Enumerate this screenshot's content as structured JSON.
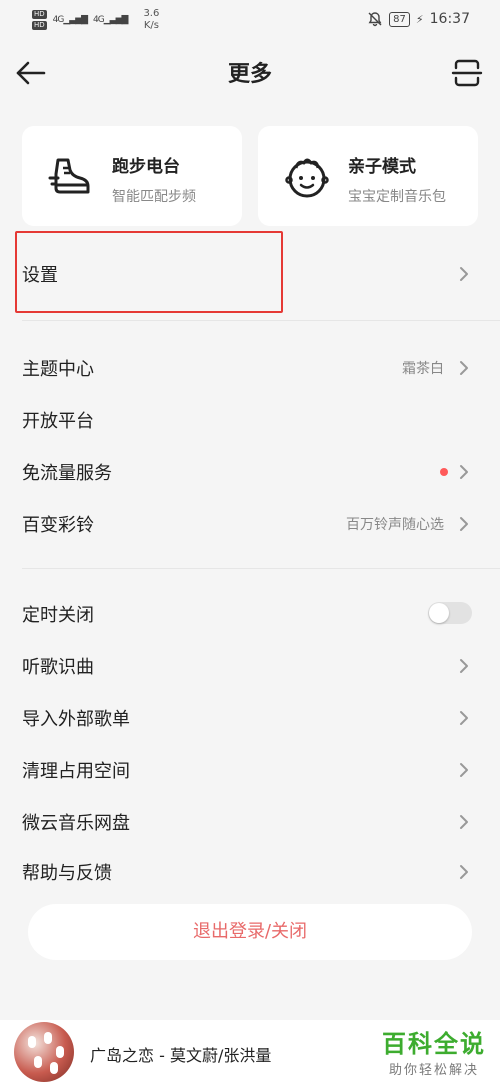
{
  "status_bar": {
    "hd_1": "HD",
    "hd_2": "HD",
    "net_1": "4G",
    "net_2": "4G",
    "speed_value": "3.6",
    "speed_unit": "K/s",
    "battery": "87",
    "time": "16:37"
  },
  "header": {
    "title": "更多",
    "back_icon": "arrow-left-icon",
    "scan_icon": "scan-icon"
  },
  "cards": [
    {
      "title": "跑步电台",
      "subtitle": "智能匹配步频",
      "icon": "running-shoe-icon"
    },
    {
      "title": "亲子模式",
      "subtitle": "宝宝定制音乐包",
      "icon": "baby-face-icon"
    }
  ],
  "settings_row": {
    "label": "设置"
  },
  "group_1": [
    {
      "label": "主题中心",
      "value": "霜茶白"
    },
    {
      "label": "开放平台"
    },
    {
      "label": "免流量服务"
    },
    {
      "label": "百变彩铃",
      "value": "百万铃声随心选"
    }
  ],
  "group_2": [
    {
      "label": "定时关闭",
      "toggle": false
    },
    {
      "label": "听歌识曲"
    },
    {
      "label": "导入外部歌单"
    },
    {
      "label": "清理占用空间"
    },
    {
      "label": "微云音乐网盘"
    },
    {
      "label": "帮助与反馈"
    }
  ],
  "logout_label": "退出登录/关闭",
  "player": {
    "song": "广岛之恋 - 莫文蔚/张洪量"
  },
  "watermark": {
    "title": "百科全说",
    "subtitle": "助你轻松解决"
  },
  "colors": {
    "accent_red": "#e53935",
    "logout_text": "#e86a6a",
    "watermark_green": "#3dac2f"
  }
}
